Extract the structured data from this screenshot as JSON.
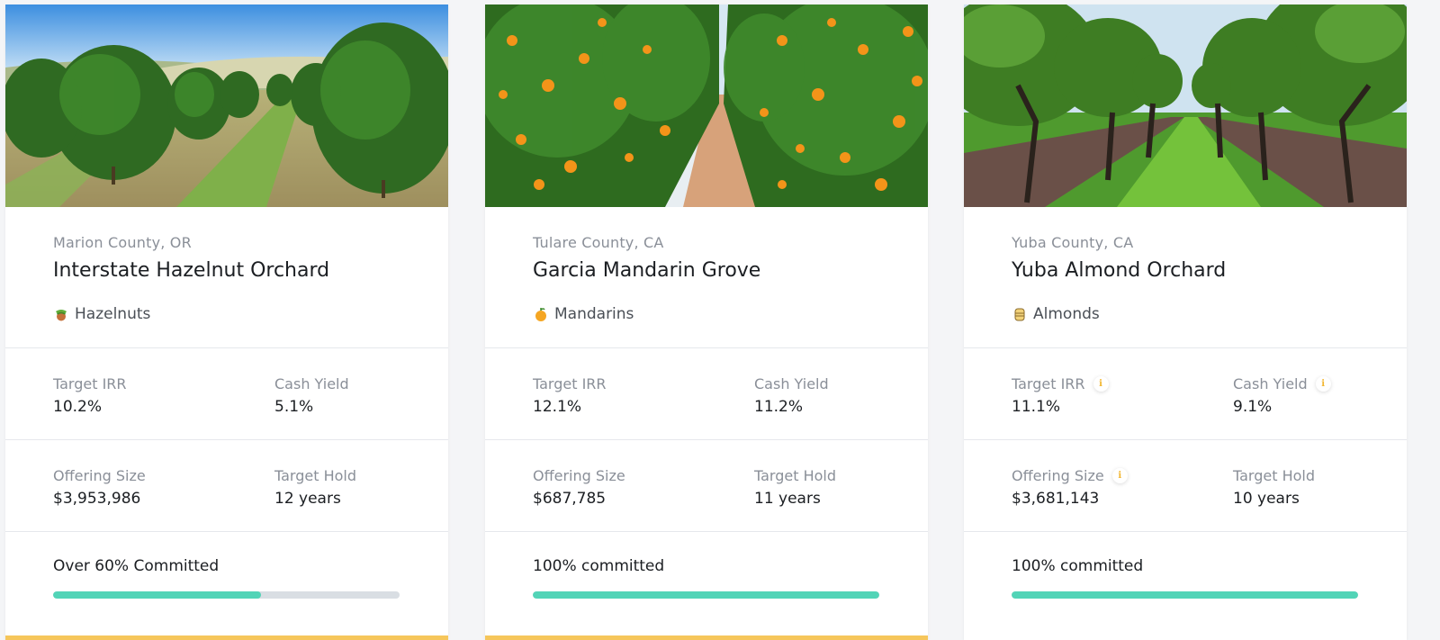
{
  "colors": {
    "progress_fill": "#52d4b7",
    "progress_track": "#d9dee3",
    "accent_bar": "#f6c65b",
    "info_icon": "#f2b630"
  },
  "cards": [
    {
      "location": "Marion County, OR",
      "title": "Interstate Hazelnut Orchard",
      "crop": "Hazelnuts",
      "crop_icon": "hazelnut-icon",
      "target_irr_label": "Target IRR",
      "target_irr": "10.2%",
      "cash_yield_label": "Cash Yield",
      "cash_yield": "5.1%",
      "offering_size_label": "Offering Size",
      "offering_size": "$3,953,986",
      "target_hold_label": "Target Hold",
      "target_hold": "12 years",
      "commitment_text": "Over 60% Committed",
      "committed_fraction": 0.6,
      "info_icons": false
    },
    {
      "location": "Tulare County, CA",
      "title": "Garcia Mandarin Grove",
      "crop": "Mandarins",
      "crop_icon": "tangerine-icon",
      "target_irr_label": "Target IRR",
      "target_irr": "12.1%",
      "cash_yield_label": "Cash Yield",
      "cash_yield": "11.2%",
      "offering_size_label": "Offering Size",
      "offering_size": "$687,785",
      "target_hold_label": "Target Hold",
      "target_hold": "11 years",
      "commitment_text": "100% committed",
      "committed_fraction": 1.0,
      "info_icons": false
    },
    {
      "location": "Yuba County, CA",
      "title": "Yuba Almond Orchard",
      "crop": "Almonds",
      "crop_icon": "almond-icon",
      "target_irr_label": "Target IRR",
      "target_irr": "11.1%",
      "cash_yield_label": "Cash Yield",
      "cash_yield": "9.1%",
      "offering_size_label": "Offering Size",
      "offering_size": "$3,681,143",
      "target_hold_label": "Target Hold",
      "target_hold": "10 years",
      "commitment_text": "100% committed",
      "committed_fraction": 1.0,
      "info_icons": true,
      "info_glyph": "i"
    }
  ]
}
